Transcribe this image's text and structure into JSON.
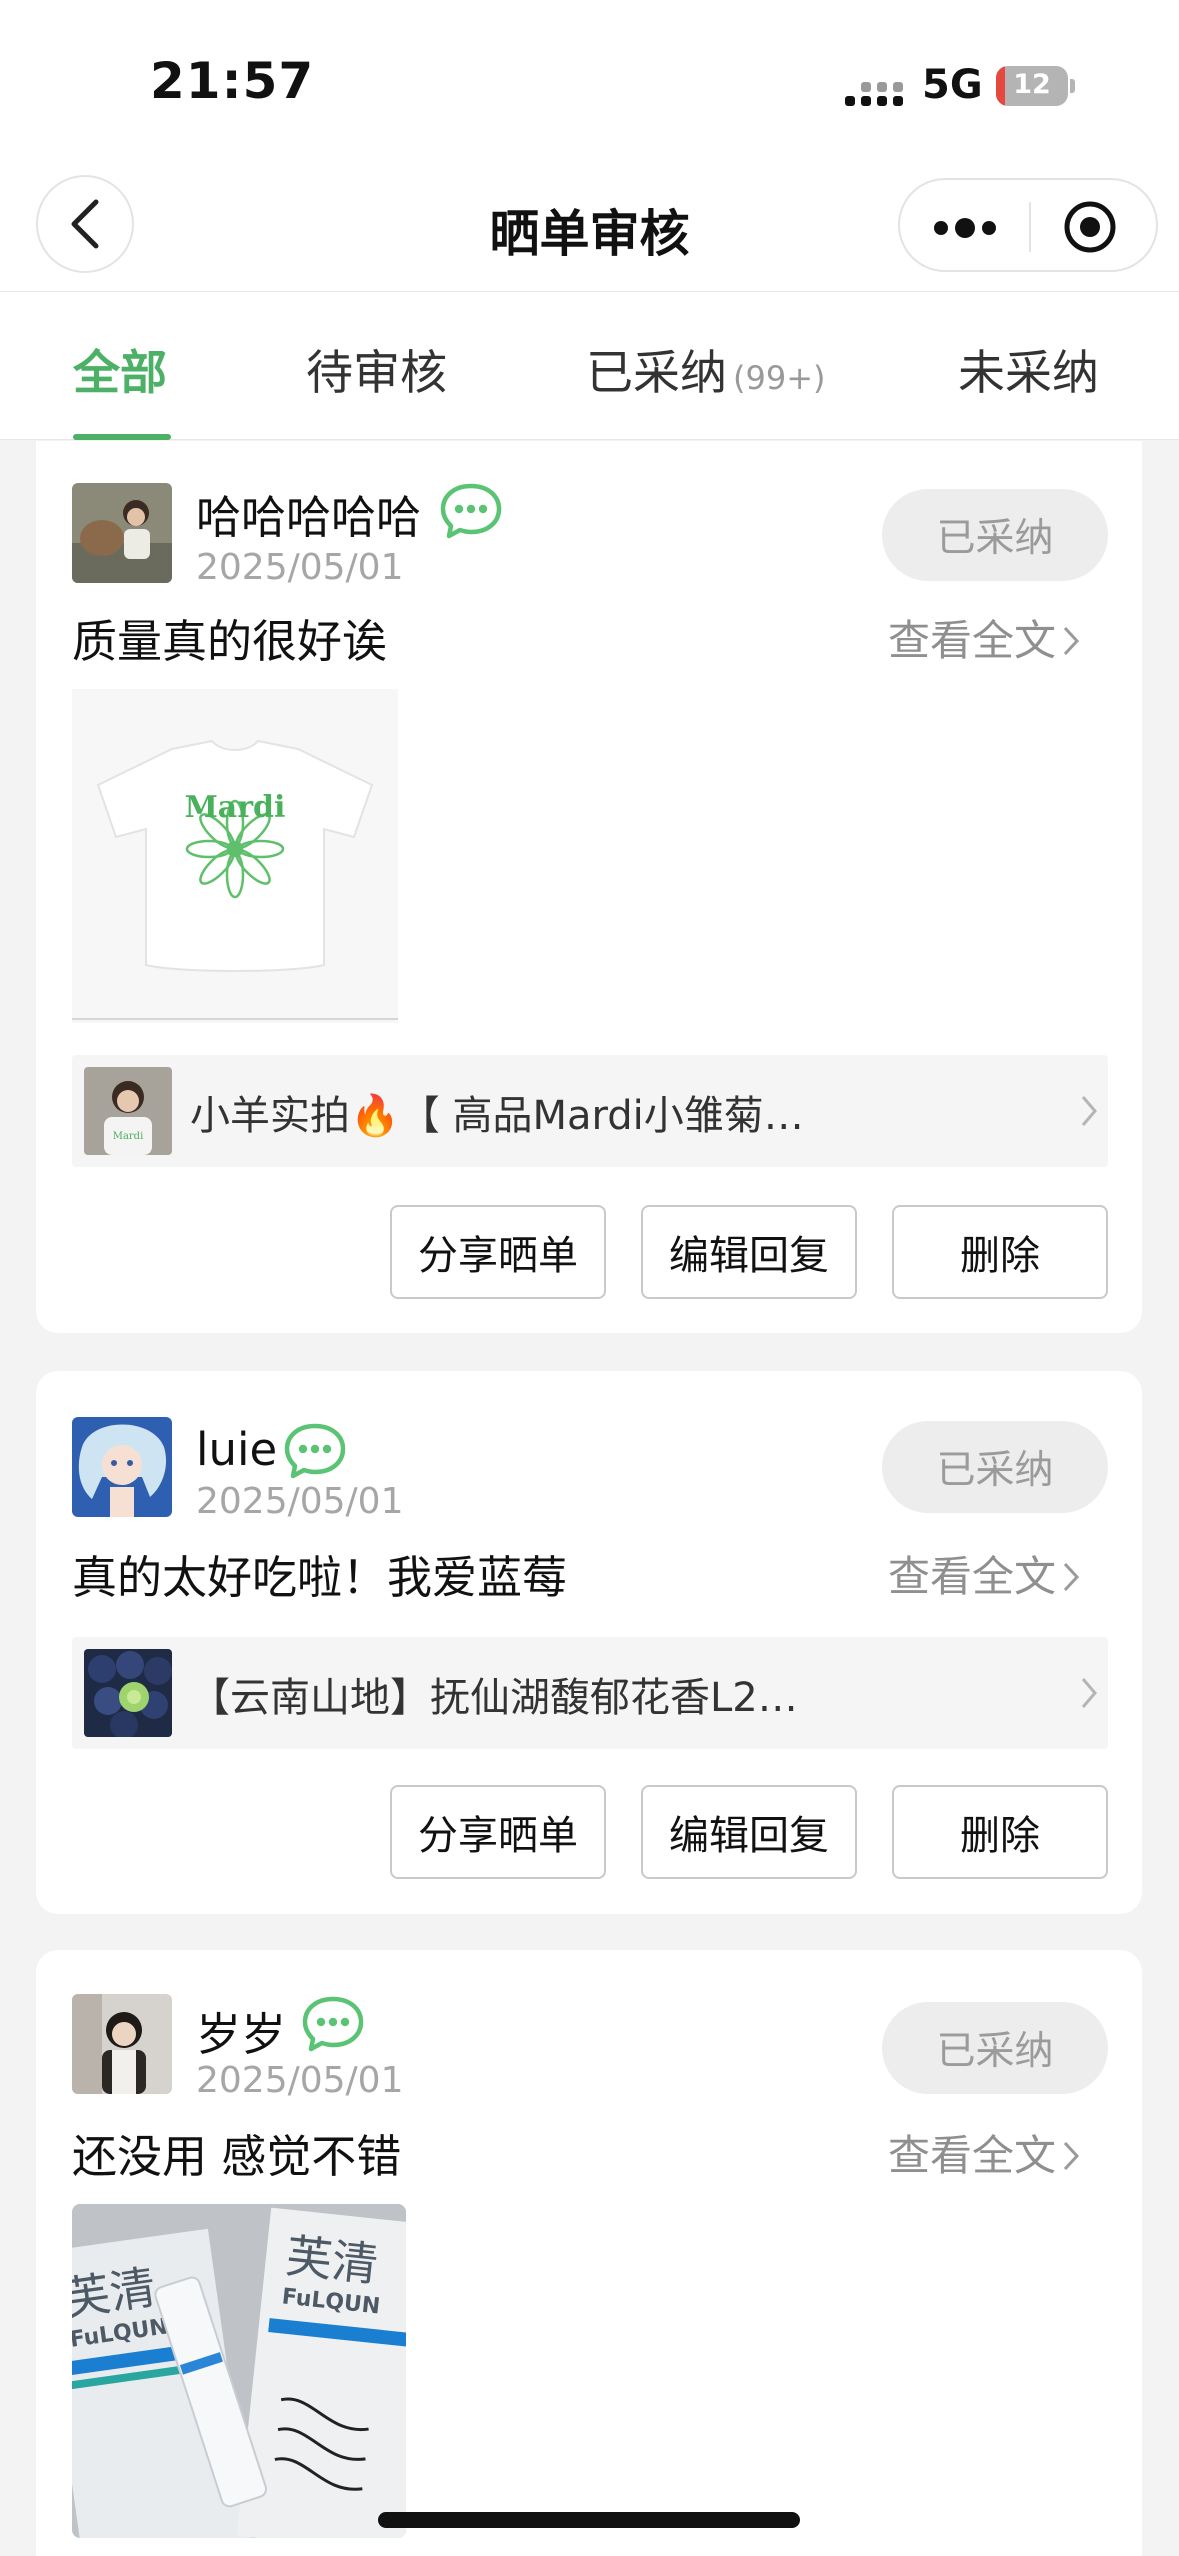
{
  "status_bar": {
    "time": "21:57",
    "network": "5G",
    "battery": "12",
    "battery_fraction": 0.12
  },
  "nav": {
    "title": "晒单审核"
  },
  "tabs": [
    {
      "label": "全部"
    },
    {
      "label": "待审核"
    },
    {
      "label": "已采纳",
      "count": "(99+)"
    },
    {
      "label": "未采纳"
    }
  ],
  "reviews": [
    {
      "user": "哈哈哈哈哈",
      "date": "2025/05/01",
      "status": "已采纳",
      "content": "质量真的很好诶",
      "view_full": "查看全文",
      "photo_text": "Mardi",
      "product_title": "小羊实拍🔥【 高品Mardi小雏菊…",
      "actions": [
        "分享晒单",
        "编辑回复",
        "删除"
      ]
    },
    {
      "user": "luie",
      "date": "2025/05/01",
      "status": "已采纳",
      "content": "真的太好吃啦！我爱蓝莓",
      "view_full": "查看全文",
      "product_title": "【云南山地】抚仙湖馥郁花香L2…",
      "actions": [
        "分享晒单",
        "编辑回复",
        "删除"
      ]
    },
    {
      "user": "岁岁",
      "date": "2025/05/01",
      "status": "已采纳",
      "content": "还没用 感觉不错",
      "view_full": "查看全文",
      "photo_text": "芙清",
      "photo_subtext": "FuLQUN"
    }
  ],
  "colors": {
    "accent": "#4cb066",
    "chat_icon": "#5ac374",
    "muted": "#a6a6a6",
    "page_bg": "#f3f3f3"
  },
  "icons": [
    "back-icon",
    "more-icon",
    "target-icon",
    "chat-bubble-icon",
    "chevron-right-icon",
    "fire-emoji"
  ]
}
